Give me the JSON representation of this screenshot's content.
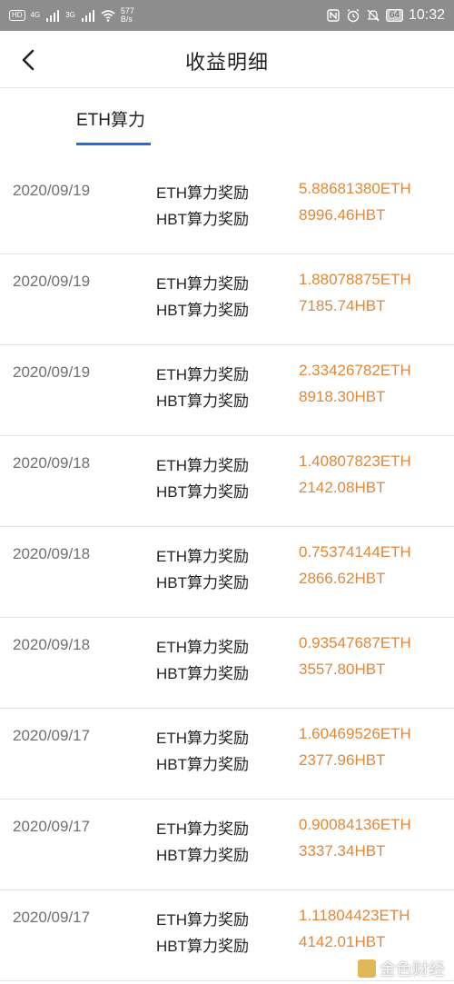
{
  "statusbar": {
    "hd": "HD",
    "net1": "4G",
    "net2": "3G",
    "speed_value": "577",
    "speed_unit": "B/s",
    "battery": "64",
    "time": "10:32"
  },
  "header": {
    "title": "收益明细"
  },
  "tabs": [
    {
      "label": "ETH算力",
      "active": true
    }
  ],
  "accent_colors": {
    "tab_underline": "#2a6dd1",
    "value": "#e0873a"
  },
  "records": [
    {
      "date": "2020/09/19",
      "eth_label": "ETH算力奖励",
      "eth_value": "5.88681380ETH",
      "hbt_label": "HBT算力奖励",
      "hbt_value": "8996.46HBT"
    },
    {
      "date": "2020/09/19",
      "eth_label": "ETH算力奖励",
      "eth_value": "1.88078875ETH",
      "hbt_label": "HBT算力奖励",
      "hbt_value": "7185.74HBT"
    },
    {
      "date": "2020/09/19",
      "eth_label": "ETH算力奖励",
      "eth_value": "2.33426782ETH",
      "hbt_label": "HBT算力奖励",
      "hbt_value": "8918.30HBT"
    },
    {
      "date": "2020/09/18",
      "eth_label": "ETH算力奖励",
      "eth_value": "1.40807823ETH",
      "hbt_label": "HBT算力奖励",
      "hbt_value": "2142.08HBT"
    },
    {
      "date": "2020/09/18",
      "eth_label": "ETH算力奖励",
      "eth_value": "0.75374144ETH",
      "hbt_label": "HBT算力奖励",
      "hbt_value": "2866.62HBT"
    },
    {
      "date": "2020/09/18",
      "eth_label": "ETH算力奖励",
      "eth_value": "0.93547687ETH",
      "hbt_label": "HBT算力奖励",
      "hbt_value": "3557.80HBT"
    },
    {
      "date": "2020/09/17",
      "eth_label": "ETH算力奖励",
      "eth_value": "1.60469526ETH",
      "hbt_label": "HBT算力奖励",
      "hbt_value": "2377.96HBT"
    },
    {
      "date": "2020/09/17",
      "eth_label": "ETH算力奖励",
      "eth_value": "0.90084136ETH",
      "hbt_label": "HBT算力奖励",
      "hbt_value": "3337.34HBT"
    },
    {
      "date": "2020/09/17",
      "eth_label": "ETH算力奖励",
      "eth_value": "1.11804423ETH",
      "hbt_label": "HBT算力奖励",
      "hbt_value": "4142.01HBT"
    }
  ],
  "watermark": {
    "text": "金色财经"
  }
}
